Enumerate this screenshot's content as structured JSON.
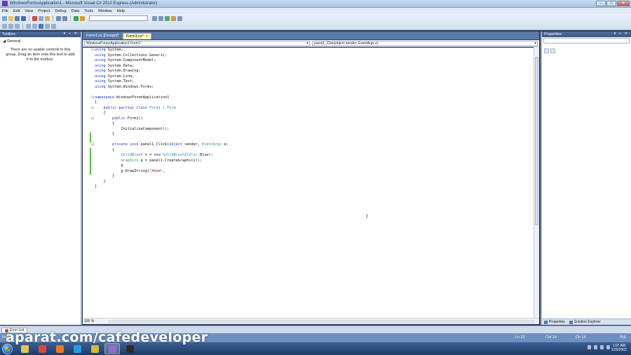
{
  "window": {
    "title": "WindowsFormsApplication1 - Microsoft Visual C# 2010 Express (Administrator)",
    "buttons": {
      "minimize": "–",
      "maximize": "□",
      "close": "✕"
    }
  },
  "menu": [
    "File",
    "Edit",
    "View",
    "Project",
    "Debug",
    "Data",
    "Tools",
    "Window",
    "Help"
  ],
  "toolbox": {
    "title": "Toolbox",
    "group": "General",
    "message": "There are no usable controls in this group. Drag an item onto this text to add it to the toolbox."
  },
  "tabs": [
    {
      "label": "Form1.cs [Design]*",
      "active": false
    },
    {
      "label": "Form1.cs*",
      "active": true
    }
  ],
  "nav": {
    "class_combo": "WindowsFormsApplication1.Form1",
    "member_combo": "panel1_Click(object sender, EventArgs e)"
  },
  "code": [
    [
      {
        "t": "kw",
        "s": "using"
      },
      {
        "t": "pl",
        "s": " System;"
      }
    ],
    [
      {
        "t": "kw",
        "s": "using"
      },
      {
        "t": "pl",
        "s": " System.Collections.Generic;"
      }
    ],
    [
      {
        "t": "kw",
        "s": "using"
      },
      {
        "t": "pl",
        "s": " System.ComponentModel;"
      }
    ],
    [
      {
        "t": "kw",
        "s": "using"
      },
      {
        "t": "pl",
        "s": " System.Data;"
      }
    ],
    [
      {
        "t": "kw",
        "s": "using"
      },
      {
        "t": "pl",
        "s": " System.Drawing;"
      }
    ],
    [
      {
        "t": "kw",
        "s": "using"
      },
      {
        "t": "pl",
        "s": " System.Linq;"
      }
    ],
    [
      {
        "t": "kw",
        "s": "using"
      },
      {
        "t": "pl",
        "s": " System.Text;"
      }
    ],
    [
      {
        "t": "kw",
        "s": "using"
      },
      {
        "t": "pl",
        "s": " System.Windows.Forms;"
      }
    ],
    [],
    [
      {
        "t": "kw",
        "s": "namespace"
      },
      {
        "t": "pl",
        "s": " WindowsFormsApplication1"
      }
    ],
    [
      {
        "t": "pl",
        "s": "{"
      }
    ],
    [
      {
        "t": "pl",
        "s": "    "
      },
      {
        "t": "kw",
        "s": "public partial class"
      },
      {
        "t": "ty",
        "s": " Form1"
      },
      {
        "t": "pl",
        "s": " : "
      },
      {
        "t": "ty",
        "s": "Form"
      }
    ],
    [
      {
        "t": "pl",
        "s": "    {"
      }
    ],
    [
      {
        "t": "pl",
        "s": "        "
      },
      {
        "t": "kw",
        "s": "public"
      },
      {
        "t": "pl",
        "s": " Form1()"
      }
    ],
    [
      {
        "t": "pl",
        "s": "        {"
      }
    ],
    [
      {
        "t": "pl",
        "s": "            InitializeComponent();"
      }
    ],
    [
      {
        "t": "pl",
        "s": "        }"
      }
    ],
    [],
    [
      {
        "t": "pl",
        "s": "        "
      },
      {
        "t": "kw",
        "s": "private void"
      },
      {
        "t": "pl",
        "s": " panel1_Click("
      },
      {
        "t": "kw",
        "s": "object"
      },
      {
        "t": "pl",
        "s": " sender, "
      },
      {
        "t": "ty",
        "s": "EventArgs"
      },
      {
        "t": "pl",
        "s": " e)"
      }
    ],
    [
      {
        "t": "pl",
        "s": "        {"
      }
    ],
    [
      {
        "t": "pl",
        "s": "            "
      },
      {
        "t": "ty",
        "s": "SolidBrush"
      },
      {
        "t": "pl",
        "s": " s = "
      },
      {
        "t": "kw",
        "s": "new"
      },
      {
        "t": "ty",
        "s": " SolidBrush"
      },
      {
        "t": "pl",
        "s": "("
      },
      {
        "t": "ty",
        "s": "Color"
      },
      {
        "t": "pl",
        "s": ".Blue);"
      }
    ],
    [
      {
        "t": "pl",
        "s": "            "
      },
      {
        "t": "ty",
        "s": "Graphics"
      },
      {
        "t": "pl",
        "s": " g = panel1.CreateGraphics();"
      }
    ],
    [
      {
        "t": "pl",
        "s": "            g"
      }
    ],
    [
      {
        "t": "pl",
        "s": "            g.DrawString("
      },
      {
        "t": "st",
        "s": "\"Adam\""
      },
      {
        "t": "pl",
        "s": ","
      }
    ],
    [
      {
        "t": "pl",
        "s": "        }"
      }
    ],
    [
      {
        "t": "pl",
        "s": "    }"
      }
    ],
    [
      {
        "t": "pl",
        "s": "}"
      }
    ]
  ],
  "editor": {
    "zoom": "100 %"
  },
  "properties": {
    "title": "Properties",
    "tabs": [
      "Properties",
      "Solution Explorer"
    ]
  },
  "error_list": {
    "label": "Error List"
  },
  "status": {
    "left": "Ready",
    "ln": "Ln 22",
    "col": "Col 14",
    "ch": "Ch 14",
    "ins": "INS"
  },
  "watermark": "aparat.com/cafedeveloper",
  "taskbar": {
    "apps": [
      {
        "name": "explorer-icon",
        "color": "#e8c15a"
      },
      {
        "name": "chrome-icon",
        "color": "#d9473b"
      },
      {
        "name": "firefox-icon",
        "color": "#e7792b"
      },
      {
        "name": "skype-icon",
        "color": "#1fa0e0"
      },
      {
        "name": "app-icon",
        "color": "#d9b63a"
      },
      {
        "name": "visual-studio-icon",
        "color": "#8f6ccf",
        "active": true
      },
      {
        "name": "terminal-icon",
        "color": "#2c2c2c"
      }
    ],
    "time": "1:07 AM",
    "date": "1/25/2002"
  },
  "colors": {
    "accent": "#3b5682",
    "keyword": "#1a33c8",
    "type": "#2a8a9a",
    "string": "#a3211f"
  }
}
